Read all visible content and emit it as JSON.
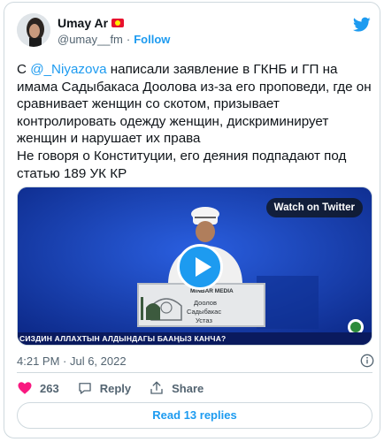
{
  "author": {
    "display_name": "Umay Ar",
    "handle": "@umay__fm",
    "separator": "·",
    "follow_label": "Follow"
  },
  "tweet": {
    "prefix": "С ",
    "mention": "@_Niyazova",
    "body": " написали заявление в ГКНБ и ГП на имама Садыбакаса Доолова из-за его проповеди, где он сравнивает женщин со скотом, призывает контролировать одежду женщин, дискриминирует женщин и нарушает их права\nНе говоря о Конституции, его деяния подпадают под статью 189 УК КР"
  },
  "media": {
    "watch_label": "Watch on Twitter",
    "plaque_title": "MINBAR MEDIA",
    "plaque_lines": [
      "Доолов",
      "Садыбакас",
      "Устаз"
    ],
    "subtitle": "СИЗДИН АЛЛАХТЫН АЛДЫНДАГЫ БААҢЫЗ КАНЧА?"
  },
  "meta": {
    "timestamp": "4:21 PM · Jul 6, 2022"
  },
  "actions": {
    "likes": "263",
    "reply_label": "Reply",
    "share_label": "Share"
  },
  "replies_label": "Read 13 replies",
  "colors": {
    "accent": "#1d9bf0",
    "like_red": "#f91880",
    "video_bg": "#1432a8"
  }
}
